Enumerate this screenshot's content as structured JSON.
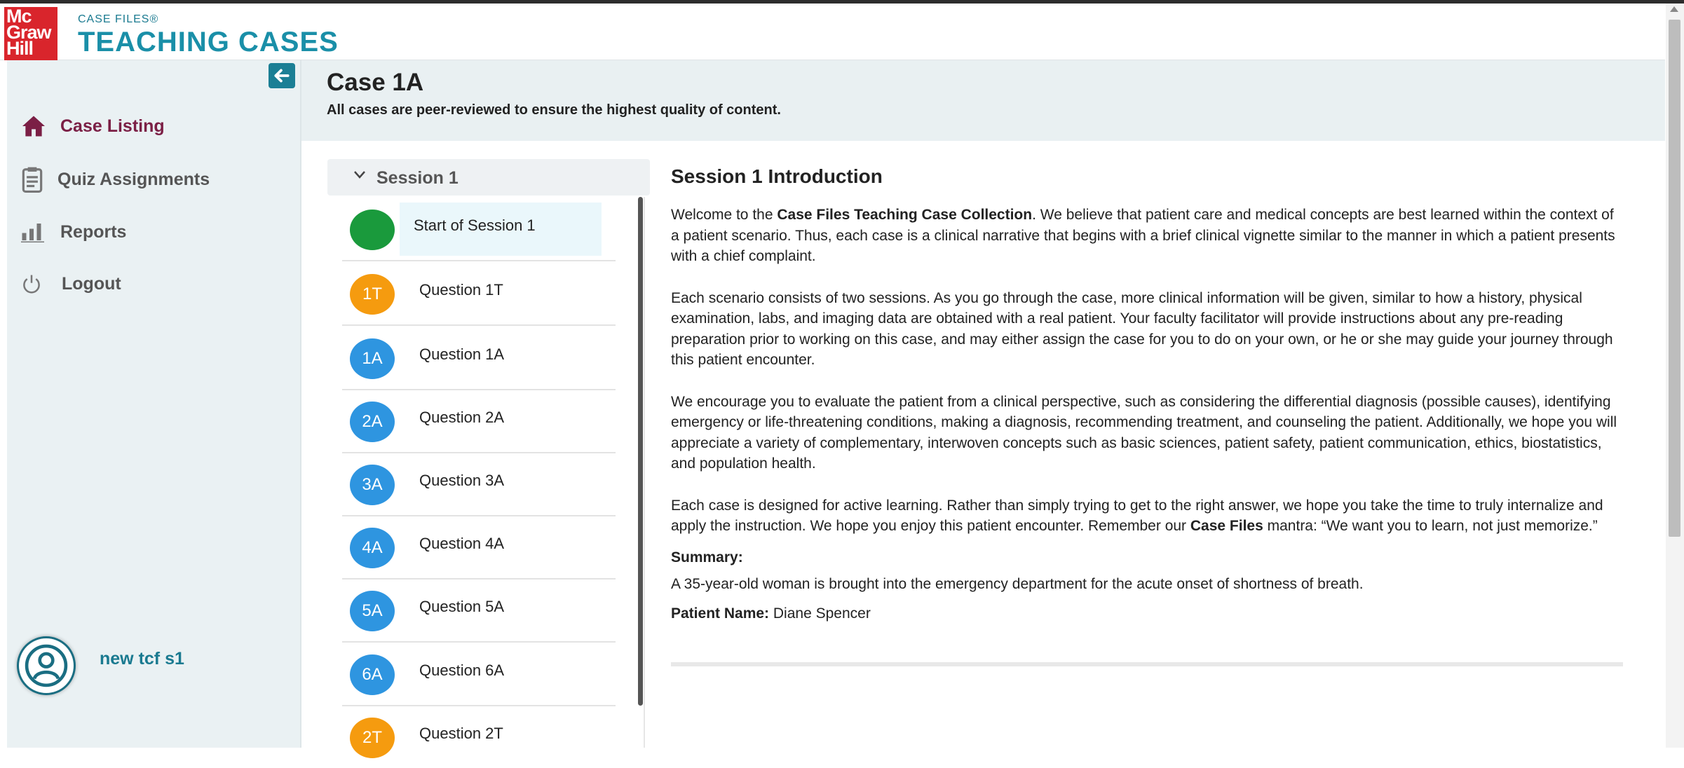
{
  "header": {
    "logo": [
      "Mc",
      "Graw",
      "Hill"
    ],
    "brand_small": "CASE FILES®",
    "brand_big": "TEACHING CASES"
  },
  "sidebar": {
    "items": [
      {
        "label": "Case Listing",
        "icon": "home-icon",
        "active": true
      },
      {
        "label": "Quiz Assignments",
        "icon": "clipboard-icon",
        "active": false
      },
      {
        "label": "Reports",
        "icon": "bar-chart-icon",
        "active": false
      },
      {
        "label": "Logout",
        "icon": "power-icon",
        "active": false
      }
    ],
    "user_name": "new tcf s1"
  },
  "main": {
    "title": "Case 1A",
    "subtitle": "All cases are peer-reviewed to ensure the highest quality of content."
  },
  "session": {
    "label": "Session 1",
    "items": [
      {
        "badge": "",
        "label": "Start of Session 1",
        "color": "#1a9a3c"
      },
      {
        "badge": "1T",
        "label": "Question 1T",
        "color": "#f59b0f"
      },
      {
        "badge": "1A",
        "label": "Question 1A",
        "color": "#2e95e0"
      },
      {
        "badge": "2A",
        "label": "Question 2A",
        "color": "#2e95e0"
      },
      {
        "badge": "3A",
        "label": "Question 3A",
        "color": "#2e95e0"
      },
      {
        "badge": "4A",
        "label": "Question 4A",
        "color": "#2e95e0"
      },
      {
        "badge": "5A",
        "label": "Question 5A",
        "color": "#2e95e0"
      },
      {
        "badge": "6A",
        "label": "Question 6A",
        "color": "#2e95e0"
      },
      {
        "badge": "2T",
        "label": "Question 2T",
        "color": "#f59b0f"
      }
    ]
  },
  "intro": {
    "heading": "Session 1 Introduction",
    "p1_a": "Welcome to the ",
    "p1_b": "Case Files Teaching Case Collection",
    "p1_c": ". We believe that patient care and medical concepts are best learned within the context of a patient scenario. Thus, each case is a clinical narrative that begins with a brief clinical vignette similar to the manner in which a patient presents with a chief complaint.",
    "p2": "Each scenario consists of two sessions. As you go through the case, more clinical information will be given, similar to how a history, physical examination, labs, and imaging data are obtained with a real patient. Your faculty facilitator will provide instructions about any pre-reading preparation prior to working on this case, and may either assign the case for you to do on your own, or he or she may guide your journey through this patient encounter.",
    "p3": "We encourage you to evaluate the patient from a clinical perspective, such as considering the differential diagnosis (possible causes), identifying emergency or life-threatening conditions, making a diagnosis, recommending treatment, and counseling the patient. Additionally, we hope you will appreciate a variety of complementary, interwoven concepts such as basic sciences, patient safety, patient communication, ethics, biostatistics, and population health.",
    "p4_a": "Each case is designed for active learning. Rather than simply trying to get to the right answer, we hope you take the time to truly internalize and apply the instruction. We hope you enjoy this patient encounter. Remember our ",
    "p4_b": "Case Files",
    "p4_c": " mantra: “We want you to learn, not just memorize.”",
    "summary_heading": "Summary:",
    "summary": "A 35-year-old woman is brought into the emergency department for the acute onset of shortness of breath.",
    "patient_label": "Patient Name:",
    "patient_name": "Diane Spencer"
  }
}
